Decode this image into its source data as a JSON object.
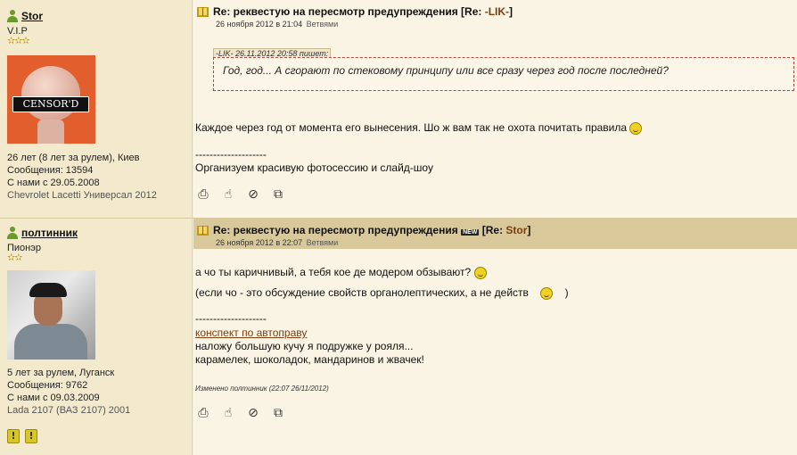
{
  "posts": [
    {
      "username": "Stor",
      "rank": "V.I.P",
      "stars": "✫✫✫",
      "avatar_text": "CENSOR'D",
      "info": [
        "26 лет (8 лет за рулем), Киев",
        "Сообщения: 13594",
        "С нами с 29.05.2008",
        "Chevrolet Lacetti Универсал 2012"
      ],
      "title": "Re: реквестую на пересмотр предупреждения [Re: ",
      "title_reply_to": "-LIK-",
      "title_end": "]",
      "date": "26 ноября 2012 в 21:04",
      "by": "Ветвями",
      "quote_header": "-LIK- 26.11.2012 20:58 пишет:",
      "quote_text": "Год, год... А сгорают по стековому принципу или все сразу через год после последней?",
      "body": "Каждое через год от момента его вынесения. Шо ж вам так не охота почитать правила",
      "separator": "--------------------",
      "signature": "Организуем красивую фотосессию и слайд-шоу"
    },
    {
      "username": "полтинник",
      "rank": "Пионэр",
      "stars": "✫✫",
      "info": [
        "5 лет за рулем, Луганск",
        "Сообщения: 9762",
        "С нами с 09.03.2009",
        "Lada 2107 (ВАЗ 2107) 2001"
      ],
      "warnings": [
        "!",
        "!"
      ],
      "title": "Re: реквестую на пересмотр предупреждения",
      "new_badge": "NEW",
      "title_reply_prefix": "[Re: ",
      "title_reply_to": "Stor",
      "title_end": "]",
      "date": "26 ноября 2012 в 22:07",
      "by": "Ветвями",
      "body_line1": "а чо ты каричнивый, а тебя кое де модером обзывают?",
      "body_line2": "(если чо - это обсуждение свойств органолептических, а не действ",
      "body_line2_end": ")",
      "separator": "--------------------",
      "sig_link": "конспект по автоправу",
      "sig_line1": "наложу большую кучу я подружке у рояля...",
      "sig_line2": "карамелек, шоколадок, мандаринов и жвачек!",
      "edited": "Изменено полтинник (22:07 26/11/2012)"
    }
  ],
  "toolbar_icons": [
    "print-icon",
    "hand-pointer-icon",
    "forbidden-icon",
    "move-icon"
  ],
  "colors": {
    "accent": "#7a3e10",
    "post_bg": "#f9f4e3",
    "sidebar_bg": "#f3e9cd",
    "title_bar_highlight": "#d9c99a",
    "quote_border": "#b7463b"
  }
}
